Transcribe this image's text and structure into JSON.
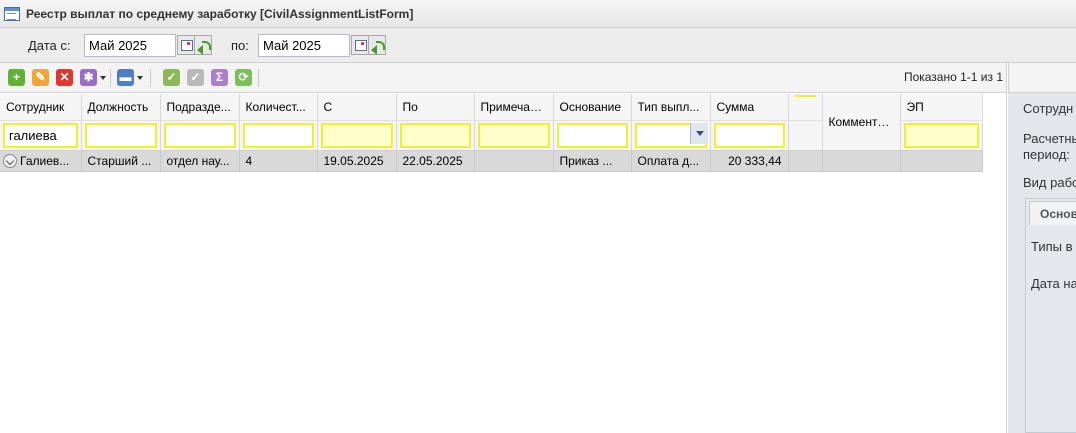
{
  "window": {
    "title": "Реестр выплат по среднему заработку [CivilAssignmentListForm]"
  },
  "filters": {
    "date_from_label": "Дата с:",
    "date_from_value": "Май 2025",
    "date_to_label": "по:",
    "date_to_value": "Май 2025"
  },
  "toolbar": {
    "icons": [
      "add-icon",
      "edit-icon",
      "delete-icon",
      "actions-icon",
      "print-icon",
      "sign-icon",
      "unsign-icon",
      "sum-icon",
      "refresh-icon"
    ],
    "shown_text": "Показано 1-1 из 1"
  },
  "grid": {
    "columns": [
      "Сотрудник",
      "Должность",
      "Подразде...",
      "Количест...",
      "С",
      "По",
      "Примечан...",
      "Основание",
      "Тип выпл...",
      "Сумма",
      "",
      "Коммента...",
      "ЭП"
    ],
    "filter_values": {
      "employee": "галиева"
    },
    "rows": [
      [
        "Галиев...",
        "Старший ...",
        "отдел нау...",
        "4",
        "19.05.2025",
        "22.05.2025",
        "",
        "Приказ ...",
        "Оплата д...",
        "20 333,44",
        "",
        "",
        ""
      ]
    ]
  },
  "side_panel": {
    "employee_label": "Сотрудн",
    "period_label_1": "Расчетны",
    "period_label_2": "период:",
    "work_type_label": "Вид рабо",
    "tab_main": "Основ",
    "payment_types_label": "Типы в",
    "date_label": "Дата на"
  },
  "colors": {
    "filter_highlight": "#f0ef33",
    "selected_row": "#d9d9d9"
  }
}
